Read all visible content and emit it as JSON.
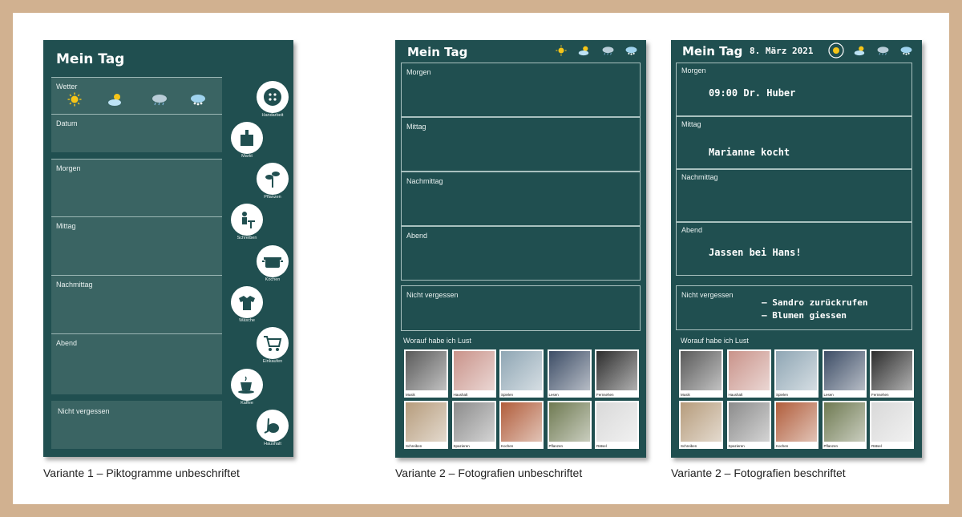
{
  "variant1": {
    "title": "Mein Tag",
    "wetter_label": "Wetter",
    "datum_label": "Datum",
    "sections": [
      "Morgen",
      "Mittag",
      "Nachmittag",
      "Abend"
    ],
    "nicht_vergessen": "Nicht vergessen",
    "pictograms": [
      {
        "label": "Handarbeit",
        "icon": "button-icon"
      },
      {
        "label": "Markt",
        "icon": "market-bag-icon"
      },
      {
        "label": "Pflanzen",
        "icon": "plant-icon"
      },
      {
        "label": "Schreiben",
        "icon": "writing-icon"
      },
      {
        "label": "Kochen",
        "icon": "cooking-pot-icon"
      },
      {
        "label": "Wäsche",
        "icon": "laundry-icon"
      },
      {
        "label": "Einkaufen",
        "icon": "shopping-cart-icon"
      },
      {
        "label": "Kaffee",
        "icon": "coffee-icon"
      },
      {
        "label": "Haushalt",
        "icon": "vacuum-icon"
      }
    ],
    "caption": "Variante 1 – Piktogramme unbeschriftet"
  },
  "variant2a": {
    "title": "Mein Tag",
    "sections": [
      "Morgen",
      "Mittag",
      "Nachmittag",
      "Abend"
    ],
    "nicht_vergessen": "Nicht vergessen",
    "lust_label": "Worauf habe ich Lust",
    "caption": "Variante 2 – Fotografien unbeschriftet"
  },
  "variant2b": {
    "title": "Mein Tag",
    "date": "8. März 2021",
    "sections": [
      "Morgen",
      "Mittag",
      "Nachmittag",
      "Abend"
    ],
    "entries": {
      "morgen": "09:00 Dr. Huber",
      "mittag": "Marianne kocht",
      "abend": "Jassen bei Hans!"
    },
    "nicht_vergessen": "Nicht vergessen",
    "notes": [
      "– Sandro zurückrufen",
      "– Blumen giessen"
    ],
    "lust_label": "Worauf habe ich Lust",
    "caption": "Variante 2 – Fotografien beschriftet"
  },
  "photos": [
    {
      "label": "Musik",
      "color": "#5a5a5a"
    },
    {
      "label": "Haushalt",
      "color": "#c9938a"
    },
    {
      "label": "Spielen",
      "color": "#8fa6b4"
    },
    {
      "label": "Lesen",
      "color": "#3d4d66"
    },
    {
      "label": "Fernsehen",
      "color": "#2d2d2d"
    },
    {
      "label": "Schreiben",
      "color": "#b69c7c"
    },
    {
      "label": "Spazieren",
      "color": "#8c8c8c"
    },
    {
      "label": "Kochen",
      "color": "#b15e3c"
    },
    {
      "label": "Pflanzen",
      "color": "#6f7a52"
    },
    {
      "label": "Rätsel",
      "color": "#d9d9d9"
    }
  ],
  "weather_icons": [
    "sun-icon",
    "sun-cloud-icon",
    "rain-cloud-icon",
    "snow-cloud-icon"
  ],
  "colors": {
    "board": "#204f50",
    "panel": "#3a6463",
    "frame": "#d1b190"
  }
}
